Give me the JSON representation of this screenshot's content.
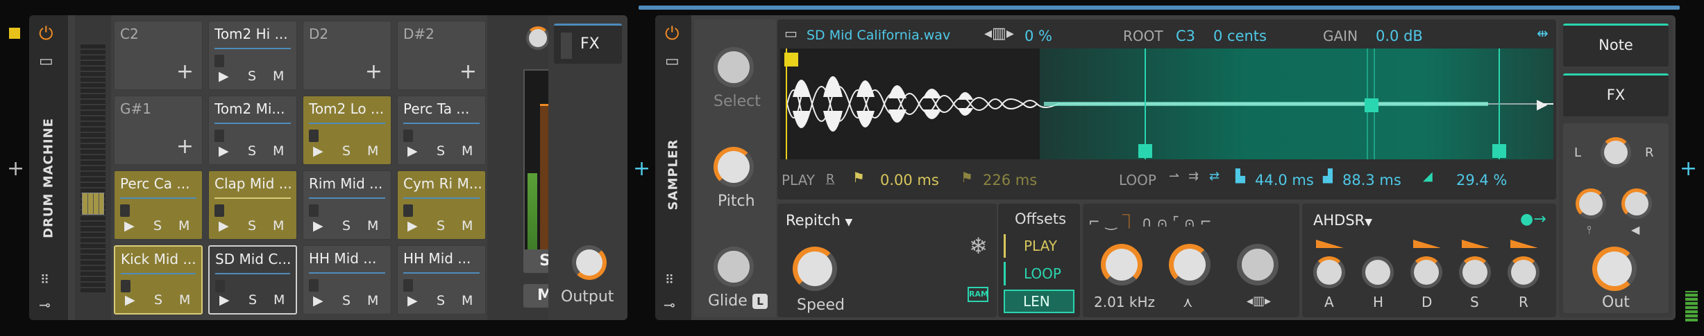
{
  "drum_machine": {
    "title": "DRUM MACHINE",
    "pads": [
      {
        "name": "C2",
        "empty": true
      },
      {
        "name": "Tom2 Hi ...",
        "empty": false
      },
      {
        "name": "D2",
        "empty": true
      },
      {
        "name": "D#2",
        "empty": true
      },
      {
        "name": "G#1",
        "empty": true
      },
      {
        "name": "Tom2 Mi...",
        "empty": false
      },
      {
        "name": "Tom2 Lo ...",
        "empty": false
      },
      {
        "name": "Perc Ta ...",
        "empty": false
      },
      {
        "name": "Perc Ca ...",
        "empty": false
      },
      {
        "name": "Clap Mid ...",
        "empty": false
      },
      {
        "name": "Rim Mid ...",
        "empty": false
      },
      {
        "name": "Cym Ri M...",
        "empty": false
      },
      {
        "name": "Kick Mid ...",
        "empty": false
      },
      {
        "name": "SD Mid C...",
        "empty": false
      },
      {
        "name": "HH Mid ...",
        "empty": false
      },
      {
        "name": "HH Mid ...",
        "empty": false
      }
    ],
    "play": "▶",
    "solo": "S",
    "mute": "M",
    "plus": "+",
    "solo_btn": "S",
    "mute_btn": "M",
    "fx_label": "FX",
    "output_label": "Output"
  },
  "sampler": {
    "title": "SAMPLER",
    "file": "SD Mid California.wav",
    "percent": "0 %",
    "root_label": "ROOT",
    "root_value": "C3",
    "cents": "0 cents",
    "gain_label": "GAIN",
    "gain_value": "0.0 dB",
    "select_label": "Select",
    "pitch_label": "Pitch",
    "glide_label": "Glide",
    "glide_badge": "L",
    "play_label": "PLAY",
    "play_r": "R",
    "play_start": "0.00 ms",
    "play_end": "226 ms",
    "loop_label": "LOOP",
    "loop_start": "44.0 ms",
    "loop_len": "88.3 ms",
    "loop_fade": "29.4 %",
    "mode": "Repitch",
    "speed_label": "Speed",
    "offsets_title": "Offsets",
    "offsets": [
      "PLAY",
      "LOOP",
      "LEN"
    ],
    "ram": "RAM",
    "filter_freq": "2.01 kHz",
    "env_title": "AHDSR",
    "env_labels": [
      "A",
      "H",
      "D",
      "S",
      "R"
    ],
    "note_btn": "Note",
    "fx_btn": "FX",
    "pan_l": "L",
    "pan_r": "R",
    "out_label": "Out"
  },
  "colors": {
    "accent": "#f08a24",
    "cyan": "#4ec9e8",
    "yellow": "#d7c65c",
    "loop_green": "#2ad6b0",
    "pad_sel": "#8a7d32"
  }
}
